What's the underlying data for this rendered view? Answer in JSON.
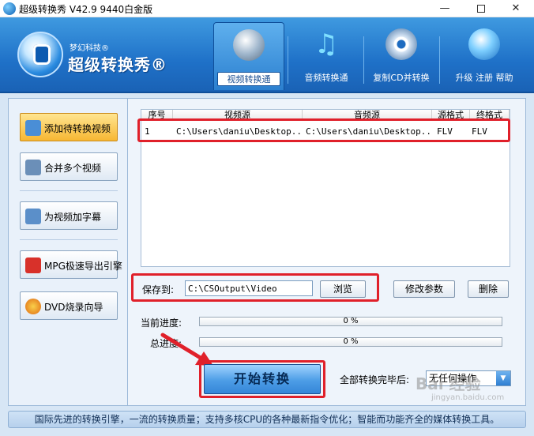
{
  "window": {
    "title": "超级转换秀 V42.9 9440白金版",
    "minimize": "—",
    "close": "✕"
  },
  "brand": {
    "sub": "梦幻科技®",
    "name": "超级转换秀®"
  },
  "tabs": [
    {
      "label": "视频转换通",
      "active": true,
      "icon": "film-reel-icon"
    },
    {
      "label": "音频转换通",
      "active": false,
      "icon": "music-note-icon"
    },
    {
      "label": "复制CD并转换",
      "active": false,
      "icon": "cd-disc-icon"
    },
    {
      "label": "升级 注册 帮助",
      "active": false,
      "icon": "globe-icon"
    }
  ],
  "sidebar": {
    "items": [
      {
        "label": "添加待转换视频",
        "icon": "add-video-icon",
        "active": true
      },
      {
        "label": "合并多个视频",
        "icon": "merge-video-icon",
        "active": false
      },
      {
        "label": "为视频加字幕",
        "icon": "subtitle-icon",
        "active": false
      },
      {
        "label": "MPG极速导出引擎",
        "icon": "mpg-engine-icon",
        "active": false
      },
      {
        "label": "DVD烧录向导",
        "icon": "dvd-burn-icon",
        "active": false
      }
    ]
  },
  "table": {
    "columns": [
      "序号",
      "视频源",
      "音频源",
      "源格式",
      "终格式"
    ],
    "rows": [
      {
        "index": "1",
        "video": "C:\\Users\\daniu\\Desktop...",
        "audio": "C:\\Users\\daniu\\Desktop...",
        "src_format": "FLV",
        "dst_format": "FLV"
      }
    ]
  },
  "save": {
    "label": "保存到:",
    "path": "C:\\CSOutput\\Video",
    "browse": "浏览",
    "params": "修改参数",
    "delete": "删除"
  },
  "progress": {
    "current_label": "当前进度:",
    "current_value": 0,
    "current_text": "0 %",
    "total_label": "总进度:",
    "total_value": 0,
    "total_text": "0 %"
  },
  "actions": {
    "start": "开始转换",
    "after_label": "全部转换完毕后:",
    "after_value": "无任何操作"
  },
  "status": {
    "text": "国际先进的转换引擎，一流的转换质量；支持多核CPU的各种最新指令优化；智能而功能齐全的媒体转换工具。"
  },
  "watermark": {
    "text": "Bai 经验",
    "sub": "jingyan.baidu.com"
  },
  "colors": {
    "header_blue": "#2b7fcf",
    "highlight_red": "#e0202a",
    "active_side_orange": "#f7b733"
  }
}
